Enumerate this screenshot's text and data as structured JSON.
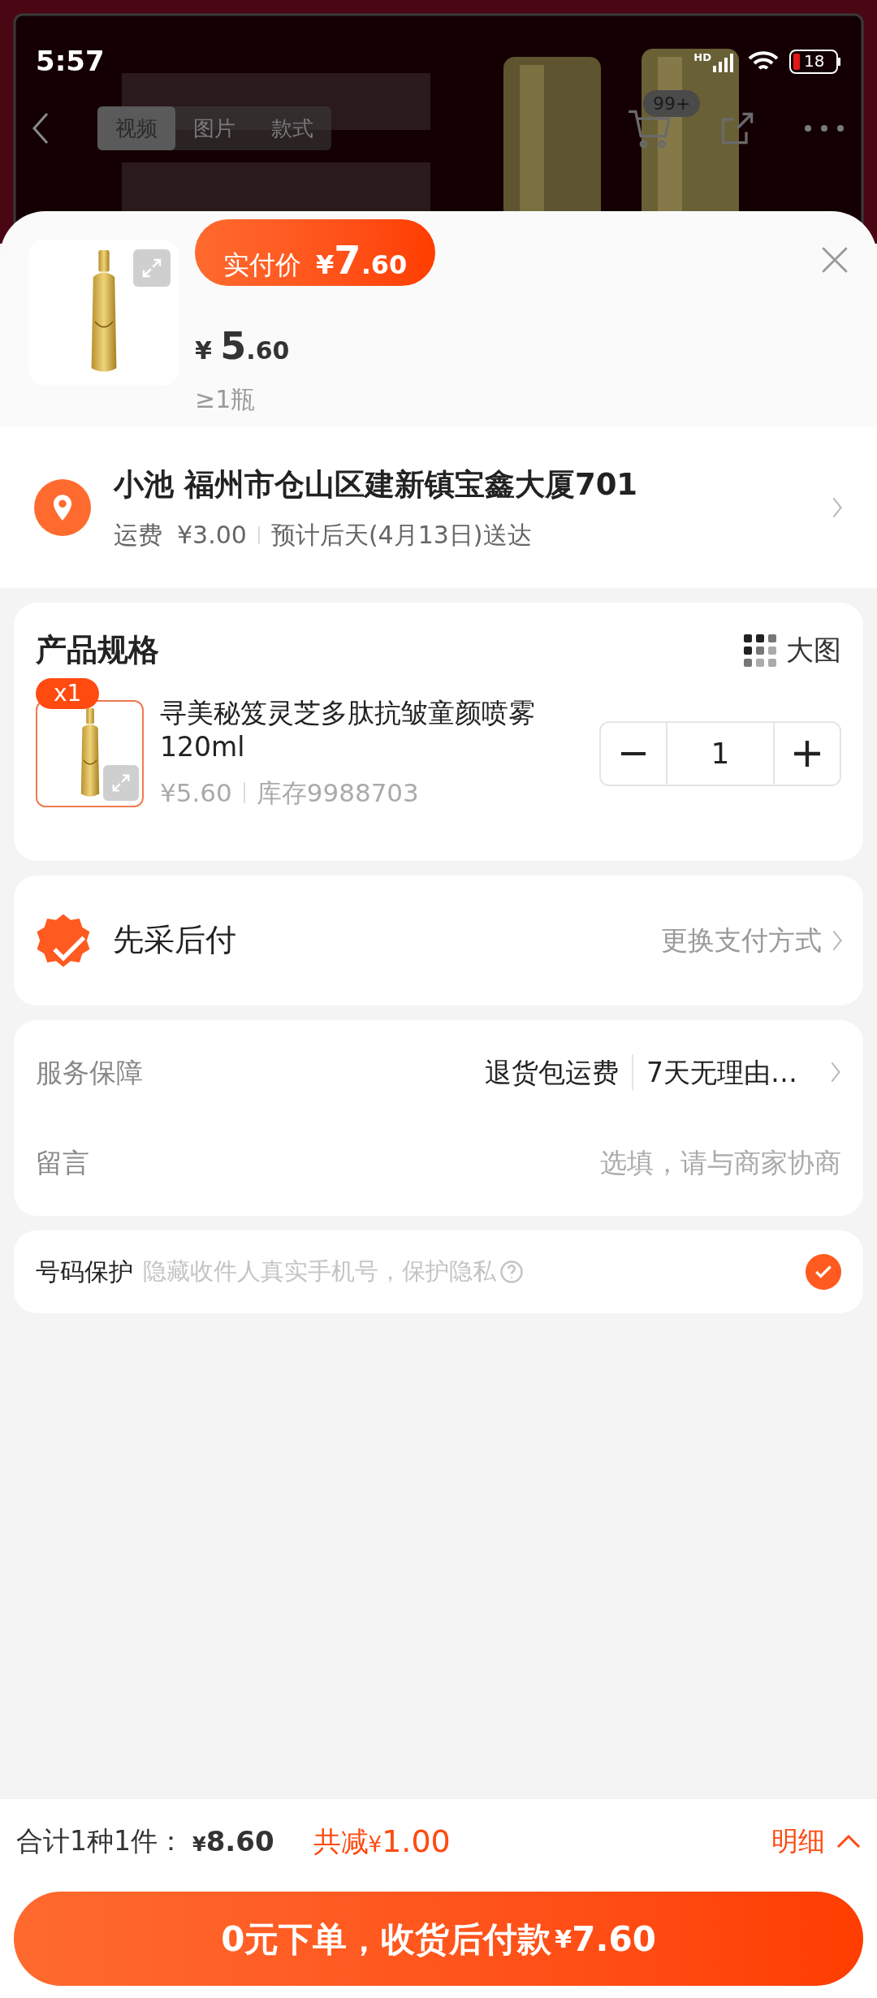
{
  "status_bar": {
    "time": "5:57",
    "network": "HD",
    "battery": "18"
  },
  "nav": {
    "tabs": [
      {
        "label": "视频",
        "selected": true
      },
      {
        "label": "图片",
        "selected": false
      },
      {
        "label": "款式",
        "selected": false
      }
    ],
    "cart_badge": "99+"
  },
  "product": {
    "pay_label": "实付价",
    "pay_currency": "¥",
    "pay_int": "7",
    "pay_dec": ".60",
    "currency": "¥",
    "price_int": "5",
    "price_dec": ".60",
    "min_qty": "≥1瓶"
  },
  "address": {
    "line": "小池 福州市仓山区建新镇宝鑫大厦701",
    "shipping_label": "运费",
    "shipping": "¥3.00",
    "eta": "预计后天(4月13日)送达"
  },
  "spec": {
    "title": "产品规格",
    "view_toggle": "大图",
    "item": {
      "count_badge": "x1",
      "name": "寻美秘笈灵芝多肽抗皱童颜喷雾120ml",
      "price": "¥5.60",
      "stock": "库存9988703",
      "quantity": "1"
    }
  },
  "payment": {
    "method": "先采后付",
    "change": "更换支付方式"
  },
  "service": {
    "label": "服务保障",
    "tags": [
      "退货包运费",
      "7天无理由…"
    ]
  },
  "message": {
    "label": "留言",
    "placeholder": "选填，请与商家协商"
  },
  "privacy": {
    "label": "号码保护",
    "hint": "隐藏收件人真实手机号，保护隐私",
    "checked": true
  },
  "footer": {
    "total_label": "合计1种1件：",
    "total_currency": "¥",
    "total": "8.60",
    "discount_label": "共减",
    "discount_currency": "¥",
    "discount": "1.00",
    "details": "明细",
    "submit_label": "0元下单，收货后付款",
    "submit_currency": "¥",
    "submit_amount": "7.60"
  }
}
